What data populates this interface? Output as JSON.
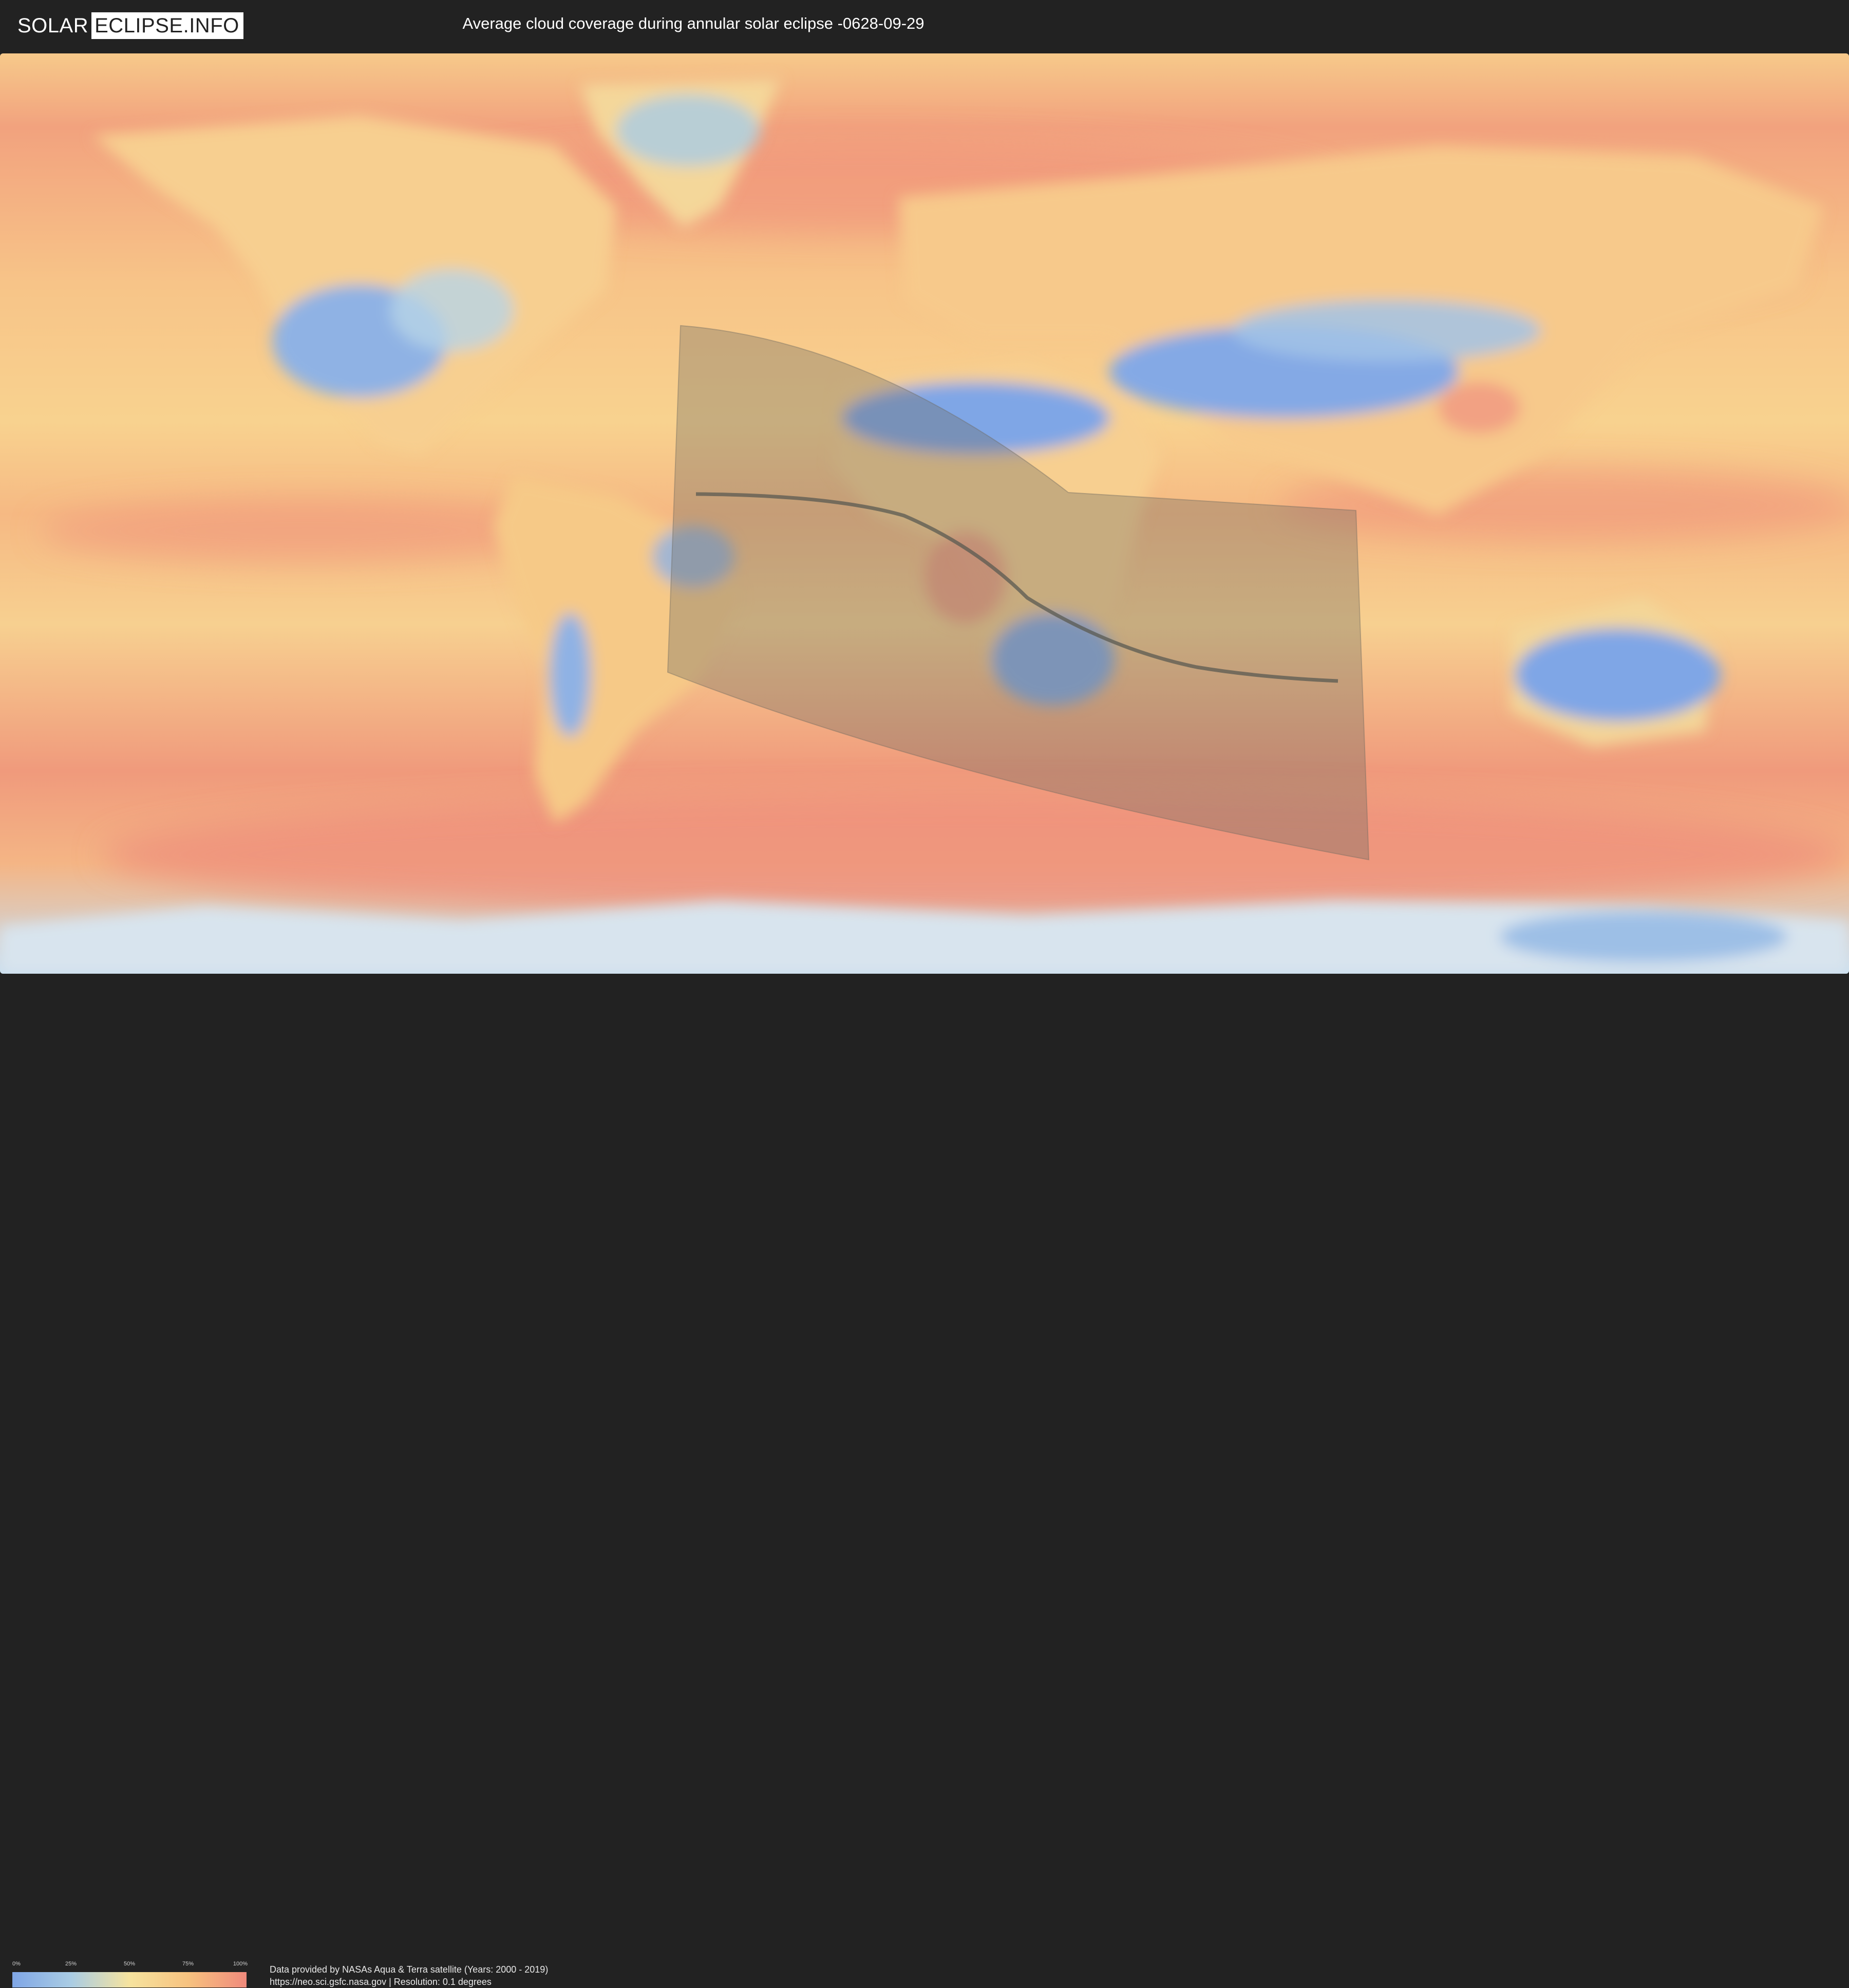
{
  "header": {
    "logo_left": "SOLAR",
    "logo_right": "ECLIPSE.INFO",
    "title": "Average cloud coverage during annular solar eclipse -0628-09-29"
  },
  "map": {
    "colors": {
      "clear": "#7fa6e6",
      "light": "#a9cce4",
      "medium": "#f6e39e",
      "high": "#f7c27f",
      "full": "#f08a7c",
      "eclipse_zone": "#6e6a60",
      "central_line": "#5a5a52"
    }
  },
  "legend": {
    "ticks": [
      "0%",
      "25%",
      "50%",
      "75%",
      "100%"
    ]
  },
  "footer": {
    "credit_line1": "Data provided by NASAs Aqua & Terra satellite (Years: 2000 - 2019)",
    "credit_line2": "https://neo.sci.gsfc.nasa.gov | Resolution: 0.1 degrees"
  }
}
